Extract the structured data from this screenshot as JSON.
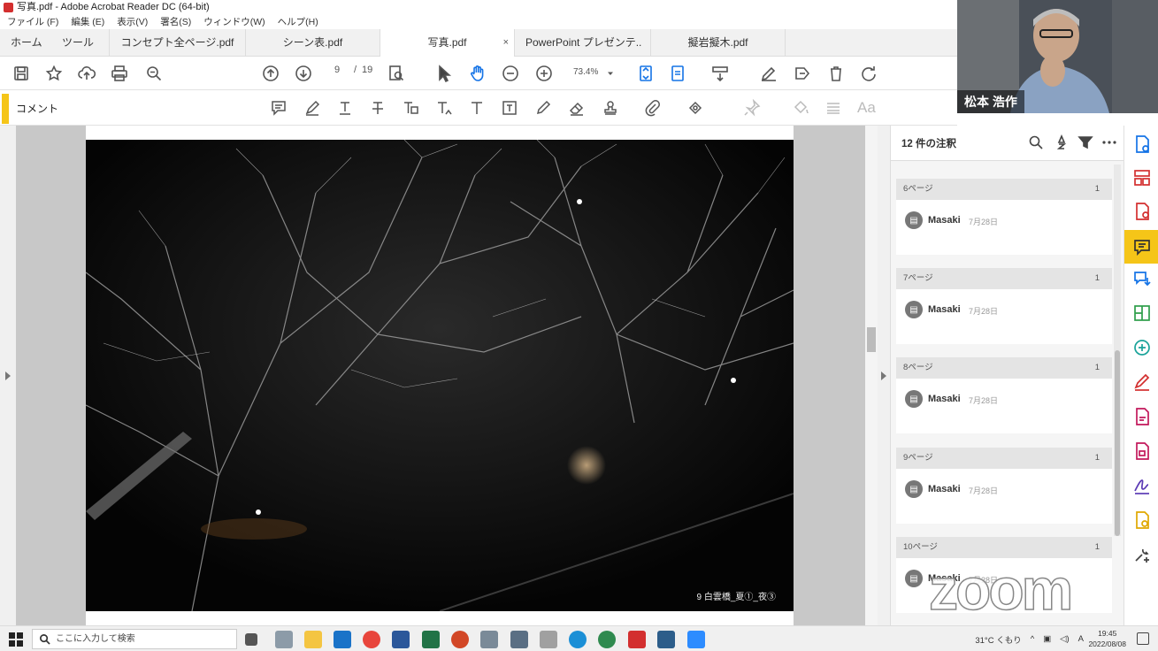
{
  "window": {
    "title": "写真.pdf - Adobe Acrobat Reader DC (64-bit)"
  },
  "menu": [
    "ファイル (F)",
    "編集 (E)",
    "表示(V)",
    "署名(S)",
    "ウィンドウ(W)",
    "ヘルプ(H)"
  ],
  "tabs": {
    "home": "ホーム",
    "tools": "ツール",
    "docs": [
      {
        "label": "コンセプト全ページ.pdf",
        "active": false
      },
      {
        "label": "シーン表.pdf",
        "active": false
      },
      {
        "label": "写真.pdf",
        "active": true
      },
      {
        "label": "PowerPoint プレゼンテ..",
        "active": false
      },
      {
        "label": "擬岩擬木.pdf",
        "active": false
      }
    ],
    "close_glyph": "×"
  },
  "toolbar": {
    "page_current": "9",
    "page_sep": "/",
    "page_total": "19",
    "zoom": "73.4%"
  },
  "comment_bar": {
    "label": "コメント",
    "font_label": "Aa"
  },
  "document": {
    "caption": "9 白雲橋_夏①_夜③"
  },
  "panel": {
    "count_label": "12 件の注釈",
    "groups": [
      {
        "page": "6ページ",
        "count": "1",
        "author": "Masaki",
        "date": "7月28日"
      },
      {
        "page": "7ページ",
        "count": "1",
        "author": "Masaki",
        "date": "7月28日"
      },
      {
        "page": "8ページ",
        "count": "1",
        "author": "Masaki",
        "date": "7月28日"
      },
      {
        "page": "9ページ",
        "count": "1",
        "author": "Masaki",
        "date": "7月28日"
      },
      {
        "page": "10ページ",
        "count": "1",
        "author": "Masaki",
        "date": "7月28日"
      }
    ]
  },
  "video": {
    "participant_name": "松本 浩作",
    "watermark": "zoom"
  },
  "taskbar": {
    "search_placeholder": "ここに入力して検索",
    "weather": "31°C くもり",
    "ime": "A",
    "time": "19:45",
    "date": "2022/08/08"
  },
  "colors": {
    "accent": "#f5c518",
    "acrobat_red": "#d32f2f"
  }
}
